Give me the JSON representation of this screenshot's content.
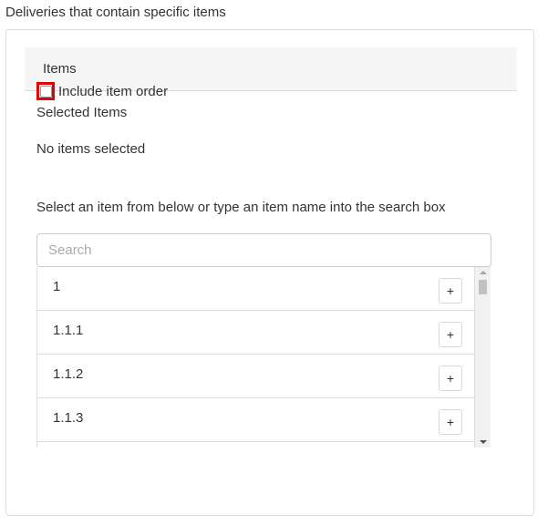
{
  "section": {
    "title": "Deliveries that contain specific items"
  },
  "panel": {
    "header": "Items",
    "include_order_label": "Include item order",
    "selected_items_title": "Selected Items",
    "no_items_text": "No items selected",
    "instructions": "Select an item from below or type an item name into the search box"
  },
  "search": {
    "placeholder": "Search",
    "value": ""
  },
  "items": [
    {
      "label": "1",
      "add_label": "+"
    },
    {
      "label": "1.1.1",
      "add_label": "+"
    },
    {
      "label": "1.1.2",
      "add_label": "+"
    },
    {
      "label": "1.1.3",
      "add_label": "+"
    }
  ],
  "colors": {
    "highlight": "#e60000",
    "header_bg": "#f5f5f5",
    "border": "#dddddd"
  },
  "icons": {
    "scroll_up": "scroll-up-arrow-icon",
    "scroll_down": "scroll-down-arrow-icon"
  }
}
